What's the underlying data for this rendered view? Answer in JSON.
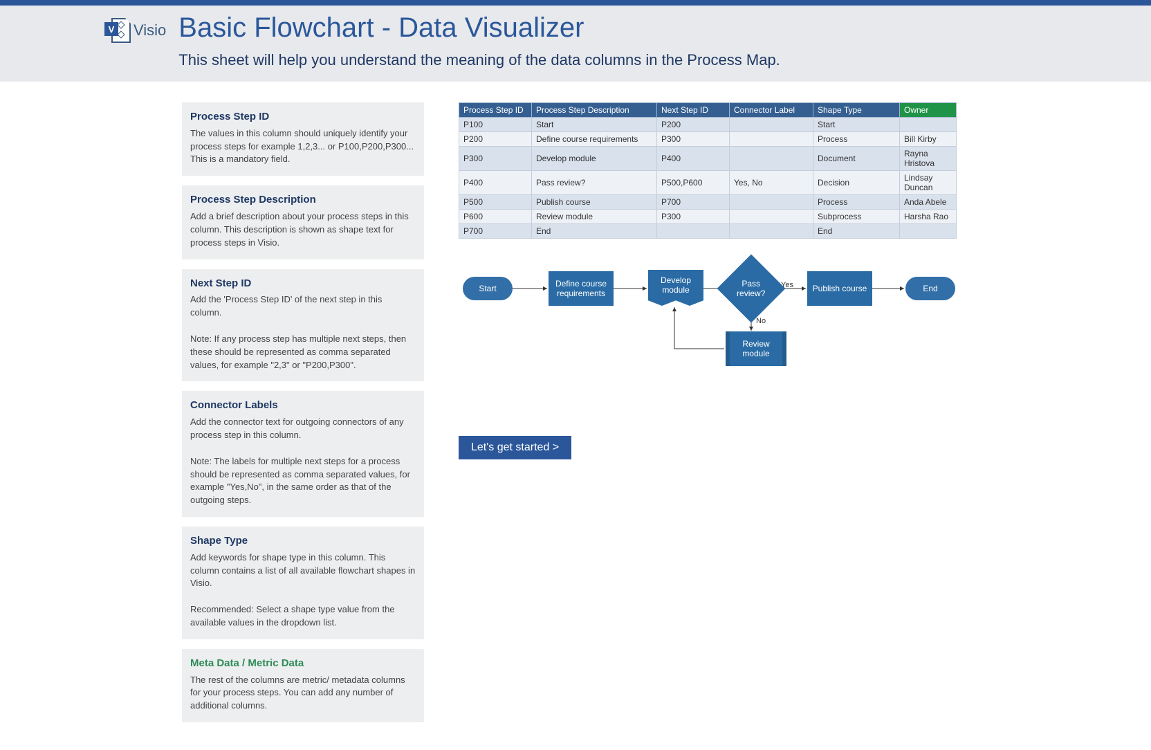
{
  "app": {
    "name": "Visio"
  },
  "header": {
    "title": "Basic Flowchart - Data Visualizer",
    "subtitle": "This sheet will help you understand the meaning of the data columns in the Process Map."
  },
  "columns_help": [
    {
      "title": "Process Step ID",
      "body": "The values in this column should uniquely identify your process steps for example 1,2,3... or P100,P200,P300... This is a mandatory field."
    },
    {
      "title": "Process Step Description",
      "body": "Add a brief description about your process steps in this column. This description is shown as shape text for process steps in Visio."
    },
    {
      "title": "Next Step ID",
      "body": "Add the 'Process Step ID' of the next step in this column.\n\nNote: If any process step has multiple next steps, then these should be represented as comma separated values, for example \"2,3\" or \"P200,P300\"."
    },
    {
      "title": "Connector Labels",
      "body": "Add the connector text for outgoing connectors of any process step in this column.\n\nNote: The labels for multiple next steps for a process should be represented as comma separated values, for example \"Yes,No\", in the same order as that of the outgoing steps."
    },
    {
      "title": "Shape Type",
      "body": "Add keywords for shape type in this column. This column contains a list of all available flowchart shapes in Visio.\n\nRecommended: Select a shape type value from the available values in the dropdown list."
    },
    {
      "title": "Meta Data / Metric Data",
      "body": "The rest of the columns are metric/ metadata columns for your process steps. You can add any number of additional columns.",
      "green": true
    }
  ],
  "table": {
    "headers": [
      "Process Step ID",
      "Process Step Description",
      "Next Step ID",
      "Connector Label",
      "Shape Type",
      "Owner"
    ],
    "rows": [
      [
        "P100",
        "Start",
        "P200",
        "",
        "Start",
        ""
      ],
      [
        "P200",
        "Define course requirements",
        "P300",
        "",
        "Process",
        "Bill Kirby"
      ],
      [
        "P300",
        "Develop module",
        "P400",
        "",
        "Document",
        "Rayna Hristova"
      ],
      [
        "P400",
        "Pass review?",
        "P500,P600",
        "Yes, No",
        "Decision",
        "Lindsay Duncan"
      ],
      [
        "P500",
        "Publish course",
        "P700",
        "",
        "Process",
        "Anda Abele"
      ],
      [
        "P600",
        "Review module",
        "P300",
        "",
        "Subprocess",
        "Harsha Rao"
      ],
      [
        "P700",
        "End",
        "",
        "",
        "End",
        ""
      ]
    ]
  },
  "flowchart": {
    "shapes": {
      "start": "Start",
      "define": "Define course requirements",
      "develop": "Develop module",
      "decision": "Pass review?",
      "publish": "Publish course",
      "end": "End",
      "review": "Review module"
    },
    "labels": {
      "yes": "Yes",
      "no": "No"
    }
  },
  "cta": {
    "label": "Let's get started >"
  }
}
